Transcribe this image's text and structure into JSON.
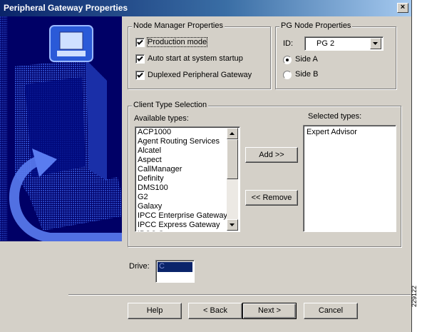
{
  "window": {
    "title": "Peripheral Gateway Properties",
    "close_glyph": "×"
  },
  "node_manager": {
    "legend": "Node Manager Properties",
    "production_mode": {
      "label": "Production mode",
      "checked": true
    },
    "auto_start": {
      "label": "Auto start at system startup",
      "checked": true
    },
    "duplexed": {
      "label": "Duplexed Peripheral Gateway",
      "checked": true
    }
  },
  "pg_node": {
    "legend": "PG Node Properties",
    "id_label": "ID:",
    "id_value": "PG 2",
    "side_a": {
      "label": "Side A",
      "selected": true
    },
    "side_b": {
      "label": "Side B",
      "selected": false
    }
  },
  "client_type": {
    "legend": "Client Type Selection",
    "available_label": "Available types:",
    "available": [
      "ACP1000",
      "Agent Routing Services",
      "Alcatel",
      "Aspect",
      "CallManager",
      "Definity",
      "DMS100",
      "G2",
      "Galaxy",
      "IPCC Enterprise Gateway",
      "IPCC Express Gateway",
      "IPCC S..."
    ],
    "selected_label": "Selected types:",
    "selected": [
      "Expert Advisor"
    ],
    "add_button": "Add >>",
    "remove_button": "<< Remove"
  },
  "drive": {
    "label": "Drive:",
    "value": "C"
  },
  "buttons": {
    "help": "Help",
    "back": "< Back",
    "next": "Next >",
    "cancel": "Cancel"
  },
  "figure_number": "229122",
  "colors": {
    "title_start": "#0a246a",
    "title_end": "#a6caf0",
    "dialog_bg": "#d4d0c8",
    "side_art": "#000066",
    "selection": "#0a246a"
  }
}
